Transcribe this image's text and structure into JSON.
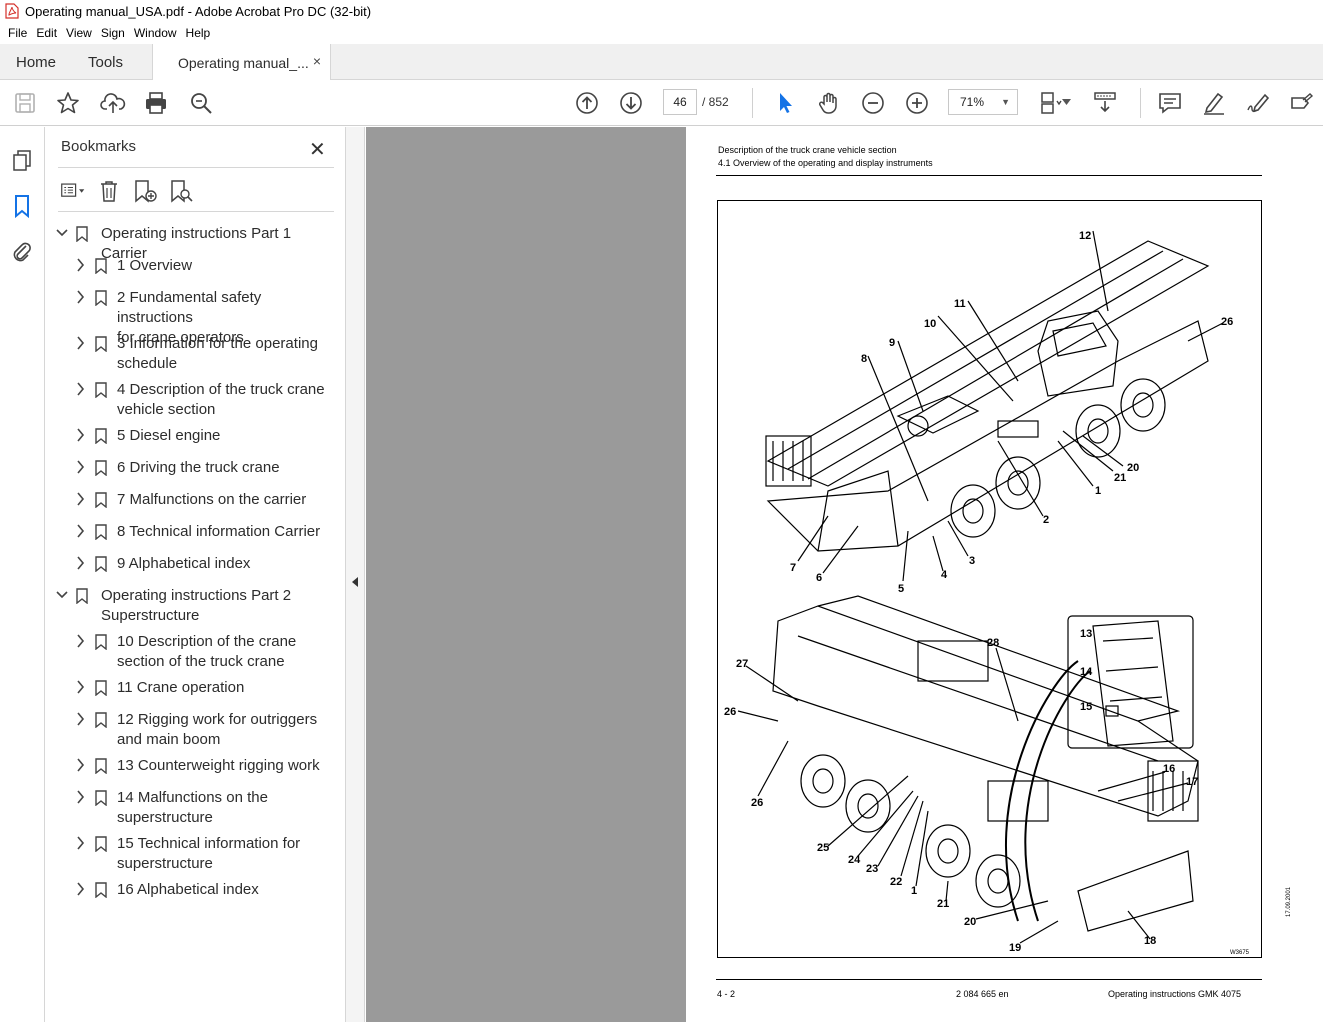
{
  "window": {
    "title": "Operating manual_USA.pdf - Adobe Acrobat Pro DC (32-bit)"
  },
  "menu": [
    "File",
    "Edit",
    "View",
    "Sign",
    "Window",
    "Help"
  ],
  "tabs": {
    "home": "Home",
    "tools": "Tools",
    "doc": "Operating manual_...",
    "close": "×"
  },
  "toolbar": {
    "page_current": "46",
    "page_total": "/  852",
    "zoom": "71%",
    "zoom_caret": "▼"
  },
  "bookmarks": {
    "title": "Bookmarks",
    "close": "✕",
    "items": [
      {
        "label": "Operating instructions Part 1 Carrier",
        "level": 0,
        "expanded": true
      },
      {
        "label": "1 Overview",
        "level": 1
      },
      {
        "label": "2 Fundamental safety instructions\nfor crane operators",
        "level": 1
      },
      {
        "label": "3 Information for the operating\nschedule",
        "level": 1
      },
      {
        "label": "4 Description of the truck crane\nvehicle section",
        "level": 1
      },
      {
        "label": "5 Diesel engine",
        "level": 1
      },
      {
        "label": "6 Driving the truck crane",
        "level": 1
      },
      {
        "label": "7 Malfunctions on the carrier",
        "level": 1
      },
      {
        "label": "8 Technical information Carrier",
        "level": 1
      },
      {
        "label": "9 Alphabetical index",
        "level": 1
      },
      {
        "label": "Operating instructions Part 2\nSuperstructure",
        "level": 0,
        "expanded": true
      },
      {
        "label": "10 Description of the crane\nsection of the truck crane",
        "level": 1
      },
      {
        "label": "11 Crane operation",
        "level": 1
      },
      {
        "label": "12 Rigging work for outriggers\nand main boom",
        "level": 1
      },
      {
        "label": "13 Counterweight rigging work",
        "level": 1
      },
      {
        "label": "14 Malfunctions on the\nsuperstructure",
        "level": 1
      },
      {
        "label": "15 Technical information for\nsuperstructure",
        "level": 1
      },
      {
        "label": "16 Alphabetical index",
        "level": 1
      }
    ]
  },
  "page": {
    "header_line1": "Description of the truck crane vehicle section",
    "header_line2": "4.1 Overview of the operating and display instruments",
    "footer_left": "4 - 2",
    "footer_center": "2 084 665 en",
    "footer_right": "Operating instructions GMK 4075",
    "date_stamp": "17.09.2001",
    "figure_code": "W3675",
    "callouts_top": [
      "12",
      "11",
      "10",
      "26",
      "9",
      "8",
      "20",
      "21",
      "1",
      "2",
      "7",
      "6",
      "5",
      "4",
      "3"
    ],
    "callouts_bottom": [
      "13",
      "14",
      "15",
      "28",
      "27",
      "26",
      "26",
      "16",
      "17",
      "25",
      "24",
      "23",
      "22",
      "1",
      "21",
      "20",
      "19",
      "18"
    ]
  }
}
